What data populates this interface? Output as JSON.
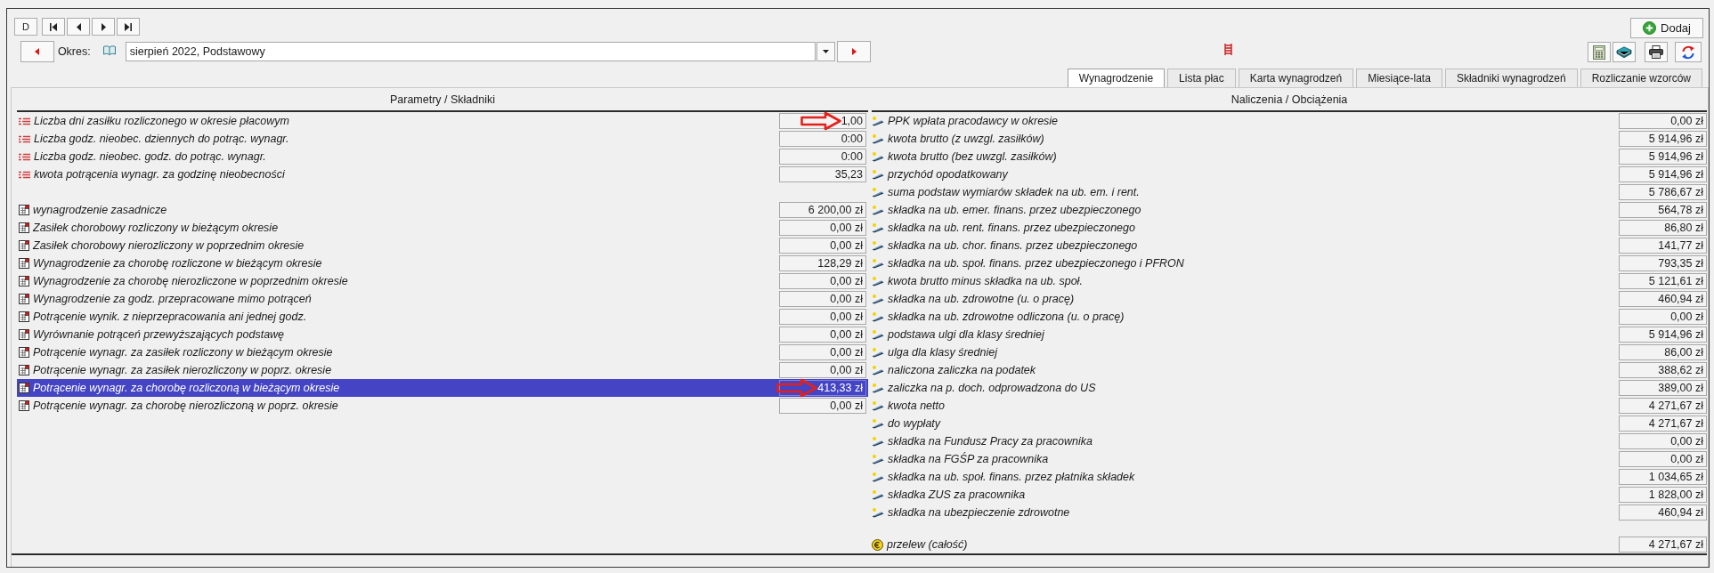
{
  "nav_toolbar": {
    "text_button": "D"
  },
  "period": {
    "label": "Okres:",
    "value": "sierpień 2022, Podstawowy"
  },
  "add_button": {
    "label": "Dodaj"
  },
  "tabs": [
    {
      "label": "Wynagrodzenie",
      "selected": true
    },
    {
      "label": "Lista płac",
      "selected": false
    },
    {
      "label": "Karta wynagrodzeń",
      "selected": false
    },
    {
      "label": "Miesiące-lata",
      "selected": false
    },
    {
      "label": "Składniki wynagrodzeń",
      "selected": false
    },
    {
      "label": "Rozliczanie wzorców",
      "selected": false
    }
  ],
  "left_panel": {
    "header": "Parametry / Składniki",
    "groups": [
      {
        "kind": "parameter",
        "rows": [
          {
            "label": "Liczba dni zasiłku rozliczonego w okresie płacowym",
            "value": "1,00",
            "selected": false,
            "annotated": true
          },
          {
            "label": "Liczba godz. nieobec. dziennych do potrąc. wynagr.",
            "value": "0:00",
            "selected": false,
            "annotated": false
          },
          {
            "label": "Liczba godz. nieobec. godz. do potrąc. wynagr.",
            "value": "0:00",
            "selected": false,
            "annotated": false
          },
          {
            "label": "kwota potrącenia wynagr. za godzinę nieobecności",
            "value": "35,23",
            "selected": false,
            "annotated": false
          }
        ]
      },
      {
        "kind": "component",
        "rows": [
          {
            "label": "wynagrodzenie zasadnicze",
            "value": "6 200,00 zł",
            "selected": false,
            "annotated": false
          },
          {
            "label": "Zasiłek chorobowy rozliczony w bieżącym okresie",
            "value": "0,00 zł",
            "selected": false,
            "annotated": false
          },
          {
            "label": "Zasiłek chorobowy nierozliczony w poprzednim okresie",
            "value": "0,00 zł",
            "selected": false,
            "annotated": false
          },
          {
            "label": "Wynagrodzenie za chorobę rozliczone w bieżącym okresie",
            "value": "128,29 zł",
            "selected": false,
            "annotated": false
          },
          {
            "label": "Wynagrodzenie za chorobę nierozliczone w poprzednim okresie",
            "value": "0,00 zł",
            "selected": false,
            "annotated": false
          },
          {
            "label": "Wynagrodzenie za godz. przepracowane mimo potrąceń",
            "value": "0,00 zł",
            "selected": false,
            "annotated": false
          },
          {
            "label": "Potrącenie wynik. z nieprzepracowania ani jednej godz.",
            "value": "0,00 zł",
            "selected": false,
            "annotated": false
          },
          {
            "label": "Wyrównanie potrąceń przewyższających podstawę",
            "value": "0,00 zł",
            "selected": false,
            "annotated": false
          },
          {
            "label": "Potrącenie wynagr. za zasiłek rozliczony w bieżącym okresie",
            "value": "0,00 zł",
            "selected": false,
            "annotated": false
          },
          {
            "label": "Potrącenie wynagr. za zasiłek nierozliczony w poprz. okresie",
            "value": "0,00 zł",
            "selected": false,
            "annotated": false
          },
          {
            "label": "Potrącenie wynagr. za chorobę rozliczoną w bieżącym okresie",
            "value": "413,33 zł",
            "selected": true,
            "annotated": true
          },
          {
            "label": "Potrącenie wynagr. za chorobę nierozliczoną w poprz. okresie",
            "value": "0,00 zł",
            "selected": false,
            "annotated": false
          }
        ]
      }
    ]
  },
  "right_panel": {
    "header": "Naliczenia / Obciążenia",
    "groups": [
      {
        "kind": "charge",
        "rows": [
          {
            "label": "PPK wpłata pracodawcy w okresie",
            "value": "0,00 zł",
            "selected": false
          },
          {
            "label": "kwota brutto (z uwzgl. zasiłków)",
            "value": "5 914,96 zł",
            "selected": false
          },
          {
            "label": "kwota brutto (bez uwzgl. zasiłków)",
            "value": "5 914,96 zł",
            "selected": false
          },
          {
            "label": "przychód opodatkowany",
            "value": "5 914,96 zł",
            "selected": false
          },
          {
            "label": "suma podstaw wymiarów składek na ub. em. i rent.",
            "value": "5 786,67 zł",
            "selected": false
          },
          {
            "label": "składka na ub. emer. finans. przez ubezpieczonego",
            "value": "564,78 zł",
            "selected": false
          },
          {
            "label": "składka na ub. rent. finans. przez ubezpieczonego",
            "value": "86,80 zł",
            "selected": false
          },
          {
            "label": "składka na ub. chor. finans. przez ubezpieczonego",
            "value": "141,77 zł",
            "selected": false
          },
          {
            "label": "składka na ub. społ. finans. przez ubezpieczonego i PFRON",
            "value": "793,35 zł",
            "selected": false
          },
          {
            "label": "kwota brutto minus składka na ub. społ.",
            "value": "5 121,61 zł",
            "selected": false
          },
          {
            "label": "składka na ub. zdrowotne (u. o pracę)",
            "value": "460,94 zł",
            "selected": false
          },
          {
            "label": "składka na ub. zdrowotne odliczona (u. o pracę)",
            "value": "0,00 zł",
            "selected": false
          },
          {
            "label": "podstawa ulgi dla klasy średniej",
            "value": "5 914,96 zł",
            "selected": false
          },
          {
            "label": "ulga dla klasy średniej",
            "value": "86,00 zł",
            "selected": false
          },
          {
            "label": "naliczona zaliczka na podatek",
            "value": "388,62 zł",
            "selected": false
          },
          {
            "label": "zaliczka na p. doch. odprowadzona do US",
            "value": "389,00 zł",
            "selected": false
          },
          {
            "label": "kwota netto",
            "value": "4 271,67 zł",
            "selected": false
          },
          {
            "label": "do wypłaty",
            "value": "4 271,67 zł",
            "selected": false
          },
          {
            "label": "składka na Fundusz Pracy za pracownika",
            "value": "0,00 zł",
            "selected": false
          },
          {
            "label": "składka na FGŚP za pracownika",
            "value": "0,00 zł",
            "selected": false
          },
          {
            "label": "składka na ub. społ. finans. przez płatnika składek",
            "value": "1 034,65 zł",
            "selected": false
          },
          {
            "label": "składka ZUS za pracownika",
            "value": "1 828,00 zł",
            "selected": false
          },
          {
            "label": "składka na ubezpieczenie zdrowotne",
            "value": "460,94 zł",
            "selected": false
          }
        ]
      },
      {
        "kind": "transfer",
        "rows": [
          {
            "label": "przelew (całość)",
            "value": "4 271,67 zł",
            "selected": false
          }
        ]
      }
    ]
  }
}
